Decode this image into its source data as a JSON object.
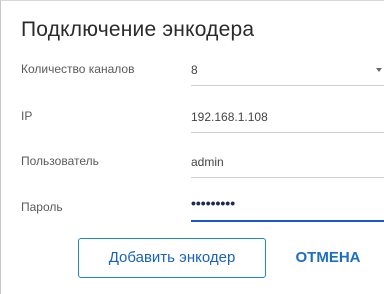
{
  "dialog": {
    "title": "Подключение энкодера"
  },
  "form": {
    "channels": {
      "label": "Количество каналов",
      "value": "8",
      "icon": "chevron-down-icon"
    },
    "ip": {
      "label": "IP",
      "value": "192.168.1.108"
    },
    "user": {
      "label": "Пользователь",
      "value": "admin"
    },
    "password": {
      "label": "Пароль",
      "value": "•••••••••"
    }
  },
  "buttons": {
    "add_label": "Добавить энкодер",
    "cancel_label": "ОТМЕНА"
  },
  "colors": {
    "accent": "#1e56c8",
    "button_border": "#1e88c8",
    "button_text": "#1a63b8"
  }
}
